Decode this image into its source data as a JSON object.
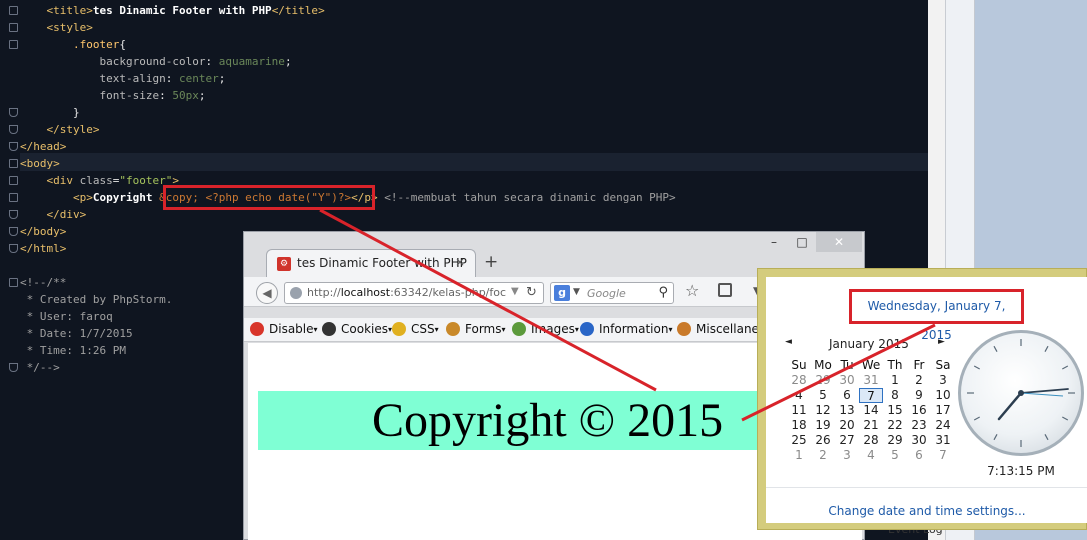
{
  "editor": {
    "lines": [
      {
        "indent": "    ",
        "parts": [
          [
            "tag",
            "<"
          ],
          [
            "tag",
            "title"
          ],
          [
            "tag",
            ">"
          ],
          [
            "text",
            "tes Dinamic Footer with PHP"
          ],
          [
            "tag",
            "</"
          ],
          [
            "tag",
            "title"
          ],
          [
            "tag",
            ">"
          ]
        ]
      },
      {
        "indent": "    ",
        "parts": [
          [
            "tag",
            "<"
          ],
          [
            "tag",
            "style"
          ],
          [
            "tag",
            ">"
          ]
        ]
      },
      {
        "indent": "        ",
        "parts": [
          [
            "css-sel",
            ".footer"
          ],
          [
            "bracket",
            "{"
          ]
        ]
      },
      {
        "indent": "            ",
        "parts": [
          [
            "css-prop",
            "background-color"
          ],
          [
            "bracket",
            ": "
          ],
          [
            "css-val",
            "aquamarine"
          ],
          [
            "bracket",
            ";"
          ]
        ]
      },
      {
        "indent": "            ",
        "parts": [
          [
            "css-prop",
            "text-align"
          ],
          [
            "bracket",
            ": "
          ],
          [
            "css-val",
            "center"
          ],
          [
            "bracket",
            ";"
          ]
        ]
      },
      {
        "indent": "            ",
        "parts": [
          [
            "css-prop",
            "font-size"
          ],
          [
            "bracket",
            ": "
          ],
          [
            "css-val",
            "50px"
          ],
          [
            "bracket",
            ";"
          ]
        ]
      },
      {
        "indent": "        ",
        "parts": [
          [
            "bracket",
            "}"
          ]
        ]
      },
      {
        "indent": "    ",
        "parts": [
          [
            "tag",
            "</"
          ],
          [
            "tag",
            "style"
          ],
          [
            "tag",
            ">"
          ]
        ]
      },
      {
        "indent": "",
        "parts": [
          [
            "tag",
            "</"
          ],
          [
            "tag",
            "head"
          ],
          [
            "tag",
            ">"
          ]
        ]
      },
      {
        "indent": "",
        "parts": [
          [
            "tag",
            "<"
          ],
          [
            "tag",
            "body"
          ],
          [
            "tag",
            ">"
          ]
        ]
      },
      {
        "indent": "    ",
        "parts": [
          [
            "tag",
            "<"
          ],
          [
            "tag",
            "div "
          ],
          [
            "attr",
            "class"
          ],
          [
            "bracket",
            "="
          ],
          [
            "val",
            "\"footer\""
          ],
          [
            "tag",
            ">"
          ]
        ]
      },
      {
        "indent": "        ",
        "parts": [
          [
            "tag",
            "<"
          ],
          [
            "tag",
            "p"
          ],
          [
            "tag",
            ">"
          ],
          [
            "text",
            "Copyright "
          ],
          [
            "php",
            "&copy; <?php echo date(\"Y\")?>"
          ],
          [
            "tag",
            "</"
          ],
          [
            "tag",
            "p"
          ],
          [
            "tag",
            "> "
          ],
          [
            "cmt",
            "<!--membuat tahun secara dinamic dengan PHP>"
          ]
        ]
      },
      {
        "indent": "    ",
        "parts": [
          [
            "tag",
            "</"
          ],
          [
            "tag",
            "div"
          ],
          [
            "tag",
            ">"
          ]
        ]
      },
      {
        "indent": "",
        "parts": [
          [
            "tag",
            "</"
          ],
          [
            "tag",
            "body"
          ],
          [
            "tag",
            ">"
          ]
        ]
      },
      {
        "indent": "",
        "parts": [
          [
            "tag",
            "</"
          ],
          [
            "tag",
            "html"
          ],
          [
            "tag",
            ">"
          ]
        ]
      },
      {
        "indent": "",
        "parts": []
      },
      {
        "indent": "",
        "parts": [
          [
            "cmt",
            "<!--/**"
          ]
        ]
      },
      {
        "indent": "",
        "parts": [
          [
            "cmt",
            " * Created by PhpStorm."
          ]
        ]
      },
      {
        "indent": "",
        "parts": [
          [
            "cmt",
            " * User: faroq"
          ]
        ]
      },
      {
        "indent": "",
        "parts": [
          [
            "cmt",
            " * Date: 1/7/2015"
          ]
        ]
      },
      {
        "indent": "",
        "parts": [
          [
            "cmt",
            " * Time: 1:26 PM"
          ]
        ]
      },
      {
        "indent": "",
        "parts": [
          [
            "cmt",
            " */-->"
          ]
        ]
      }
    ],
    "event_log": "Event Log"
  },
  "browser": {
    "window_min": "–",
    "window_max": "□",
    "window_close": "✕",
    "tab_title": "tes Dinamic Footer with PHP",
    "tab_close": "×",
    "new_tab": "+",
    "url_host": "localhost",
    "url_rest": ":63342/kelas-php/foc",
    "search_placeholder": "Google",
    "toolbar": [
      {
        "label": "Disable",
        "icon_color": "#d8352a"
      },
      {
        "label": "Cookies",
        "icon_color": "#333333"
      },
      {
        "label": "CSS",
        "icon_color": "#e0b020"
      },
      {
        "label": "Forms",
        "icon_color": "#c9892a"
      },
      {
        "label": "Images",
        "icon_color": "#5c9a3c"
      },
      {
        "label": "Information",
        "icon_color": "#2a66c7"
      },
      {
        "label": "Miscellaneous",
        "icon_color": "#c97a2a"
      }
    ],
    "page_footer_text": "Copyright © 2015",
    "footer_color": "#7fffd4"
  },
  "clock_popup": {
    "full_date": "Wednesday, January 7, 2015",
    "month_label": "January 2015",
    "prev": "◄",
    "next": "►",
    "weekdays": [
      "Su",
      "Mo",
      "Tu",
      "We",
      "Th",
      "Fr",
      "Sa"
    ],
    "weeks": [
      [
        "28",
        "29",
        "30",
        "31",
        "1",
        "2",
        "3"
      ],
      [
        "4",
        "5",
        "6",
        "7",
        "8",
        "9",
        "10"
      ],
      [
        "11",
        "12",
        "13",
        "14",
        "15",
        "16",
        "17"
      ],
      [
        "18",
        "19",
        "20",
        "21",
        "22",
        "23",
        "24"
      ],
      [
        "25",
        "26",
        "27",
        "28",
        "29",
        "30",
        "31"
      ],
      [
        "1",
        "2",
        "3",
        "4",
        "5",
        "6",
        "7"
      ]
    ],
    "today": "7",
    "time": "7:13:15 PM",
    "settings_link": "Change date and time settings..."
  },
  "colors": {
    "annotation_red": "#d8232a",
    "editor_bg": "#0f1520",
    "popup_border": "#d4cc7d"
  }
}
